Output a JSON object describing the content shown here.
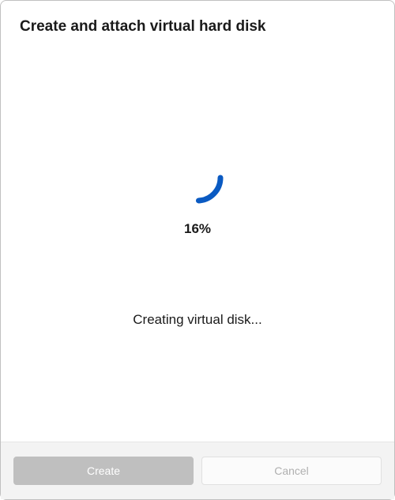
{
  "header": {
    "title": "Create and attach virtual hard disk"
  },
  "progress": {
    "percent_label": "16%",
    "status_text": "Creating virtual disk..."
  },
  "footer": {
    "create_label": "Create",
    "cancel_label": "Cancel"
  }
}
